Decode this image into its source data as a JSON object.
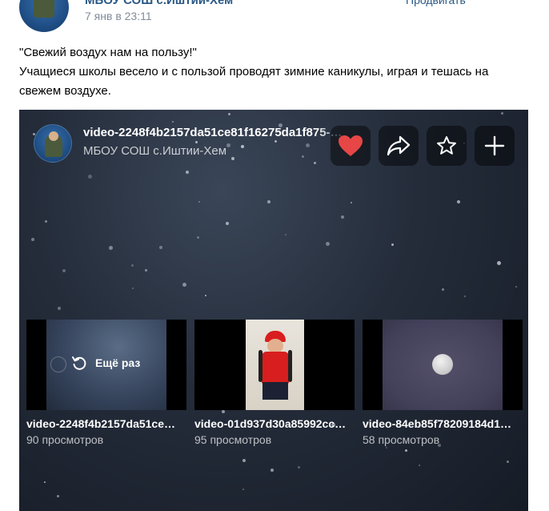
{
  "post": {
    "author": "МБОУ СОШ с.Иштии-Хем",
    "date": "7 янв в 23:11",
    "promote_label": "Продвигать",
    "more_label": "···",
    "text_line1": "\"Свежий воздух нам на пользу!\"",
    "text_line2": "Учащиеся школы весело и с пользой проводят зимние каникулы, играя и тешась на свежем воздухе."
  },
  "video": {
    "title": "video-2248f4b2157da51ce81f16275da1f875-…",
    "channel": "МБОУ СОШ с.Иштии-Хем",
    "actions": [
      "like-icon",
      "share-icon",
      "favorite-icon",
      "add-icon"
    ],
    "like_color": "#e64646"
  },
  "related": [
    {
      "title": "video-2248f4b2157da51ce…",
      "views": "90 просмотров",
      "replay_label": "Ещё раз"
    },
    {
      "title": "video-01d937d30a85992cc…",
      "views": "95 просмотров"
    },
    {
      "title": "video-84eb85f78209184d1…",
      "views": "58 просмотров"
    }
  ]
}
